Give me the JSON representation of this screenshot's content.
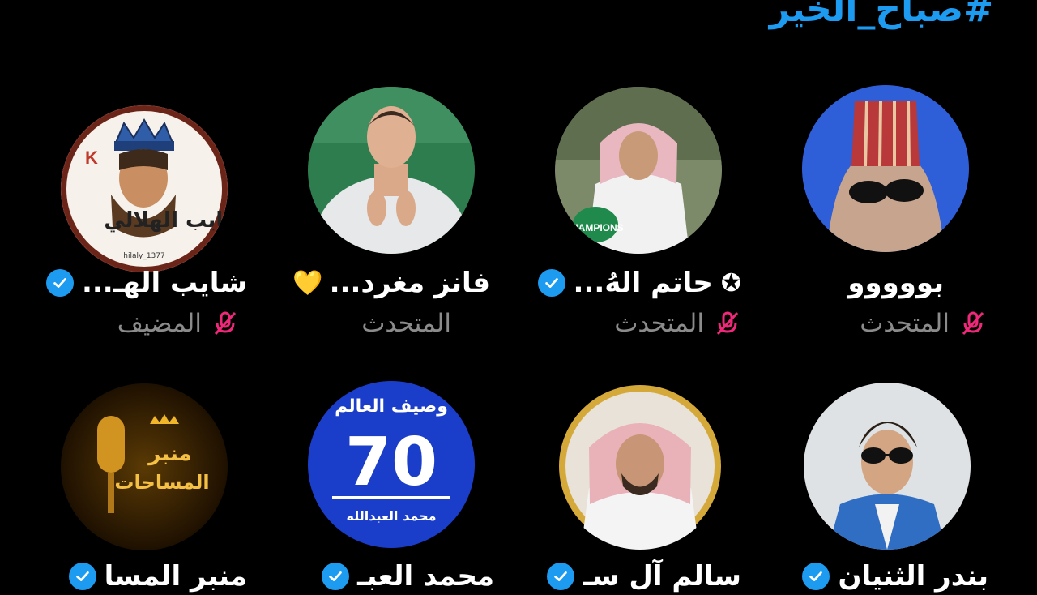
{
  "hashtag": "#صباح_الخير",
  "speakers": [
    {
      "name": "شايب الهـ...",
      "role": "المضيف",
      "verified": true
    },
    {
      "name": "فانز مغرد...",
      "role": "المتحدث",
      "verified": false,
      "emoji": "💛"
    },
    {
      "name": "حاتم الهُ...",
      "role": "المتحدث",
      "verified": true,
      "star": "✪"
    },
    {
      "name": "بووووو",
      "role": "المتحدث",
      "verified": false
    },
    {
      "name": "منبر المسا",
      "role": "",
      "verified": true
    },
    {
      "name": "محمد العبـ",
      "role": "",
      "verified": true
    },
    {
      "name": "سالم آل سـ",
      "role": "",
      "verified": true
    },
    {
      "name": "بندر الثنيان",
      "role": "",
      "verified": true
    }
  ],
  "avatar_texts": {
    "king_logo": "شايب الهلالي",
    "king_handle": "hilaly_1377",
    "k_letter": "K",
    "champions": "CHAMPIONS",
    "wasif_title": "وصيف العالم",
    "wasif_number": "70",
    "wasif_name": "محمد العبدالله",
    "minbar_line1": "منبر",
    "minbar_line2": "المساحات"
  },
  "colors": {
    "accent": "#1d9bf0",
    "muted_icon": "#f0287a",
    "role_text": "#8b8b8b"
  }
}
